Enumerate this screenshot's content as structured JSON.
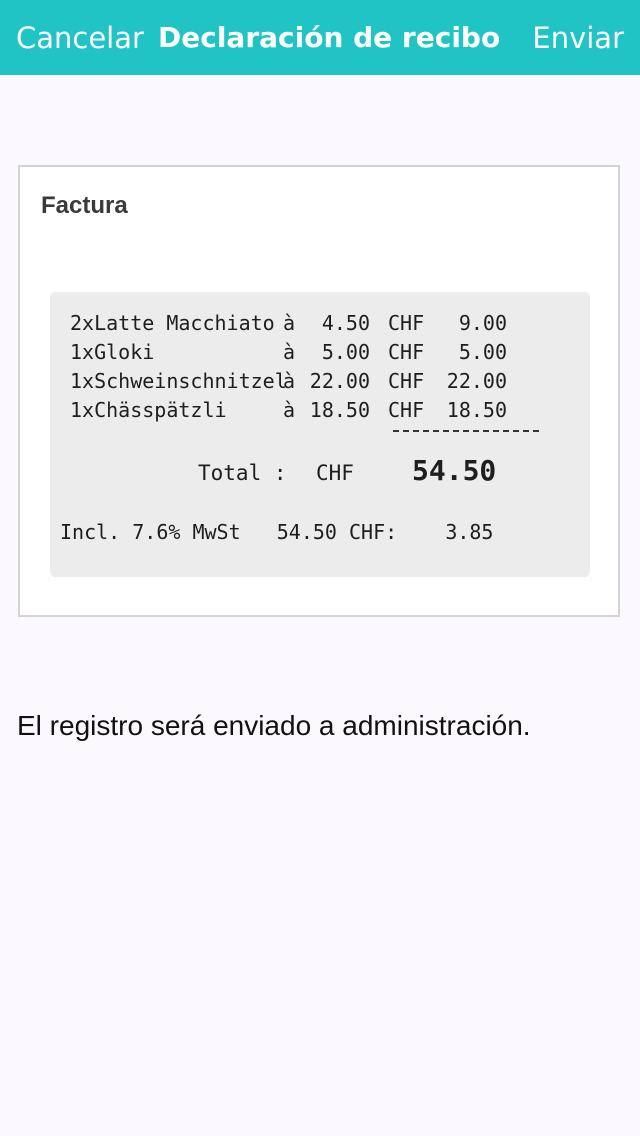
{
  "navbar": {
    "cancel_label": "Cancelar",
    "title": "Declaración de recibo",
    "send_label": "Enviar",
    "background_color": "#20c4c4"
  },
  "card": {
    "heading": "Factura"
  },
  "receipt": {
    "items": [
      {
        "item": "2xLatte Macchiato",
        "at": "à",
        "price": "4.50",
        "currency": "CHF",
        "amount": "9.00"
      },
      {
        "item": "1xGloki",
        "at": "à",
        "price": "5.00",
        "currency": "CHF",
        "amount": "5.00"
      },
      {
        "item": "1xSchweinschnitzel",
        "at": "à",
        "price": "22.00",
        "currency": "CHF",
        "amount": "22.00"
      },
      {
        "item": "1xChässpätzli",
        "at": "à",
        "price": "18.50",
        "currency": "CHF",
        "amount": "18.50"
      }
    ],
    "total_label": "Total :",
    "total_currency": "CHF",
    "total_value": "54.50",
    "tax_line": "Incl. 7.6% MwSt   54.50 CHF:    3.85"
  },
  "info_text": "El registro será enviado a administración."
}
